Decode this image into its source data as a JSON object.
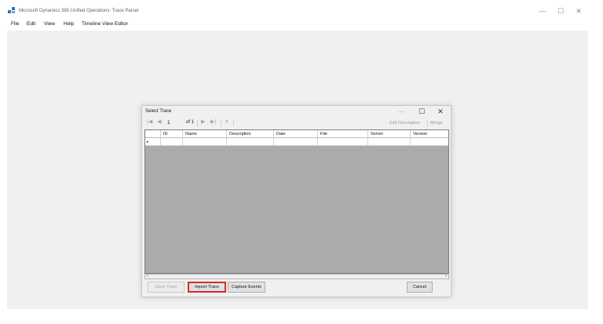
{
  "window": {
    "title": "Microsoft Dynamics 365 Unified Operations: Trace Parser",
    "controls": {
      "minimize": "—",
      "maximize": "☐",
      "close": "✕"
    }
  },
  "menu": {
    "items": [
      "File",
      "Edit",
      "View",
      "Help",
      "Timeline View Editor"
    ]
  },
  "dialog": {
    "title": "Select Trace",
    "controls": {
      "minimize": "—",
      "maximize": "☐",
      "close": "✕"
    },
    "navigator": {
      "first": "|◀",
      "prev": "◀",
      "position": "1",
      "of_label": "of 1",
      "next": "▶",
      "last": "▶|",
      "delete": "✕",
      "edit_description": "Edit Description",
      "merge": "Merge"
    },
    "grid": {
      "columns": [
        "ID",
        "Name",
        "Description",
        "Date",
        "File",
        "Server",
        "Version"
      ],
      "rows": [
        {
          "indicator": "▸",
          "cells": [
            "",
            "",
            "",
            "",
            "",
            "",
            ""
          ]
        }
      ]
    },
    "scrollbar": {
      "left": "‹",
      "right": "›"
    },
    "buttons": {
      "open_trace": "Open Trace",
      "import_trace": "Import Trace",
      "capture_events": "Capture Events",
      "cancel": "Cancel"
    }
  }
}
